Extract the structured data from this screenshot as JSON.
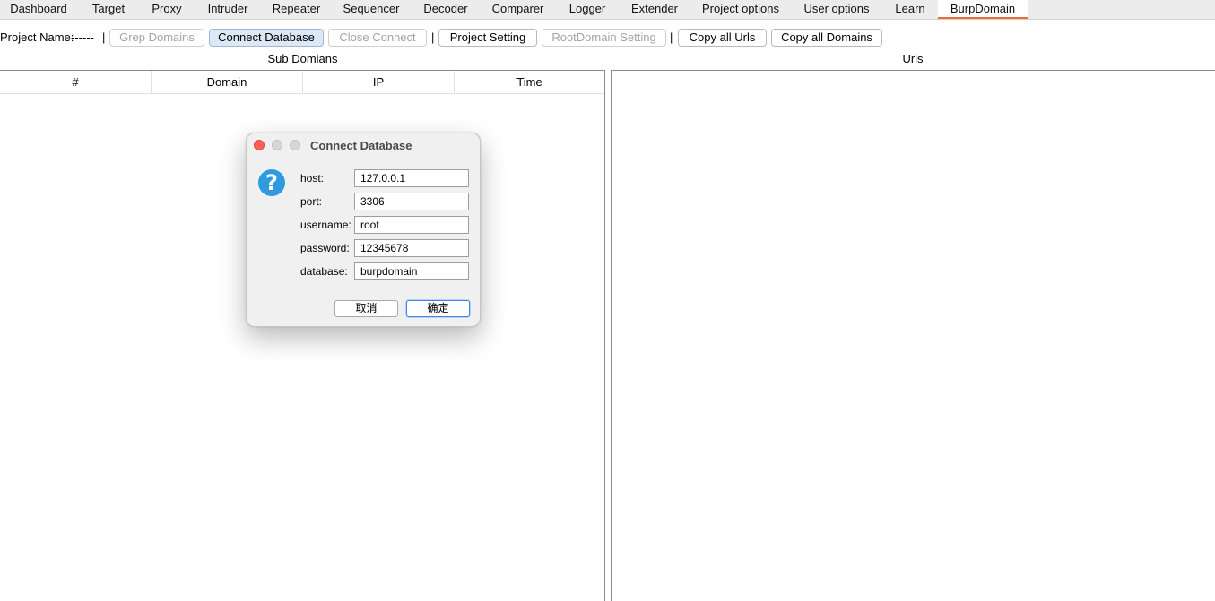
{
  "tabs": [
    {
      "label": "Dashboard"
    },
    {
      "label": "Target"
    },
    {
      "label": "Proxy"
    },
    {
      "label": "Intruder"
    },
    {
      "label": "Repeater"
    },
    {
      "label": "Sequencer"
    },
    {
      "label": "Decoder"
    },
    {
      "label": "Comparer"
    },
    {
      "label": "Logger"
    },
    {
      "label": "Extender"
    },
    {
      "label": "Project options"
    },
    {
      "label": "User options"
    },
    {
      "label": "Learn"
    },
    {
      "label": "BurpDomain"
    }
  ],
  "active_tab": "BurpDomain",
  "accent_color": "#f26a36",
  "toolbar": {
    "project_name_label": "Project Name:",
    "project_name_value": "------",
    "separator": "|",
    "grep_domains": "Grep Domains",
    "connect_database": "Connect Database",
    "close_connect": "Close Connect",
    "project_setting": "Project Setting",
    "rootdomain_setting": "RootDomain Setting",
    "copy_all_urls": "Copy all Urls",
    "copy_all_domains": "Copy all Domains"
  },
  "left_panel": {
    "title": "Sub Domians",
    "columns": [
      "#",
      "Domain",
      "IP",
      "Time"
    ]
  },
  "right_panel": {
    "title": "Urls"
  },
  "dialog": {
    "title": "Connect Database",
    "icon": "question-icon",
    "fields": {
      "host": {
        "label": "host:",
        "value": "127.0.0.1"
      },
      "port": {
        "label": "port:",
        "value": "3306"
      },
      "username": {
        "label": "username:",
        "value": "root"
      },
      "password": {
        "label": "password:",
        "value": "12345678"
      },
      "database": {
        "label": "database:",
        "value": "burpdomain"
      }
    },
    "cancel_label": "取消",
    "ok_label": "确定"
  }
}
